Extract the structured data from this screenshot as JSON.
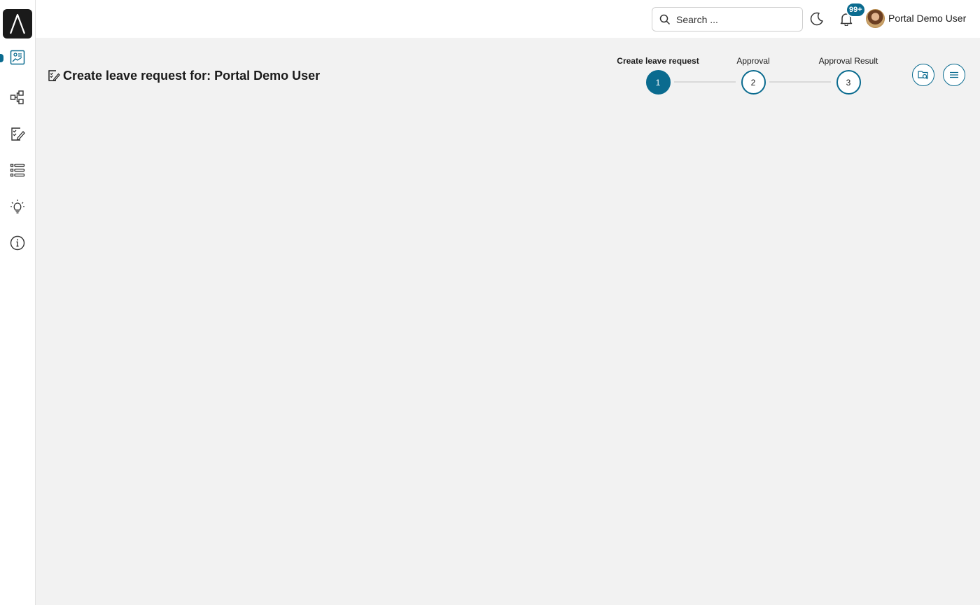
{
  "colors": {
    "accent": "#0a6b8f",
    "background": "#f2f2f2",
    "surface": "#ffffff"
  },
  "sidebar": {
    "logo_icon": "lambda-logo-icon",
    "items": [
      {
        "name": "dashboard",
        "icon": "dashboard-icon",
        "active": true
      },
      {
        "name": "processes",
        "icon": "process-tree-icon"
      },
      {
        "name": "tasks",
        "icon": "task-edit-icon"
      },
      {
        "name": "cases",
        "icon": "list-icon"
      },
      {
        "name": "ideas",
        "icon": "lightbulb-icon"
      },
      {
        "name": "info",
        "icon": "info-icon"
      }
    ]
  },
  "header": {
    "search": {
      "placeholder": "Search ..."
    },
    "notifications_badge": "99+",
    "user_name": "Portal Demo User"
  },
  "page": {
    "title": "Create leave request for: Portal Demo User"
  },
  "stepper": {
    "steps": [
      {
        "label": "Create leave request",
        "number": "1",
        "active": true
      },
      {
        "label": "Approval",
        "number": "2",
        "active": false
      },
      {
        "label": "Approval Result",
        "number": "3",
        "active": false
      }
    ]
  }
}
